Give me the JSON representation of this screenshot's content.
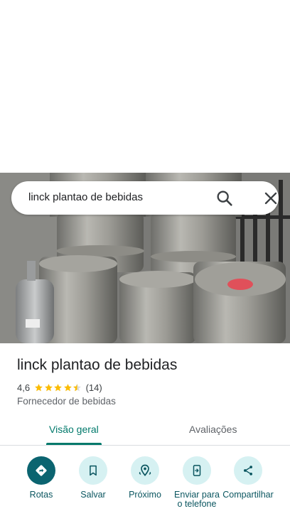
{
  "search": {
    "query": "linck plantao de bebidas"
  },
  "place": {
    "name": "linck plantao de bebidas",
    "rating": "4,6",
    "stars": 4.6,
    "review_count": "(14)",
    "category": "Fornecedor de bebidas"
  },
  "tabs": [
    {
      "label": "Visão geral",
      "active": true
    },
    {
      "label": "Avaliações",
      "active": false
    }
  ],
  "actions": [
    {
      "label": "Rotas",
      "icon": "directions-icon"
    },
    {
      "label": "Salvar",
      "icon": "bookmark-icon"
    },
    {
      "label": "Próximo",
      "icon": "nearby-icon"
    },
    {
      "label": "Enviar para o telefone",
      "icon": "send-to-phone-icon"
    },
    {
      "label": "Compartilhar",
      "icon": "share-icon"
    }
  ],
  "colors": {
    "accent": "#00796b",
    "action_primary": "#0b6470",
    "action_bg": "#d6f1f2",
    "star": "#fbbc04"
  }
}
